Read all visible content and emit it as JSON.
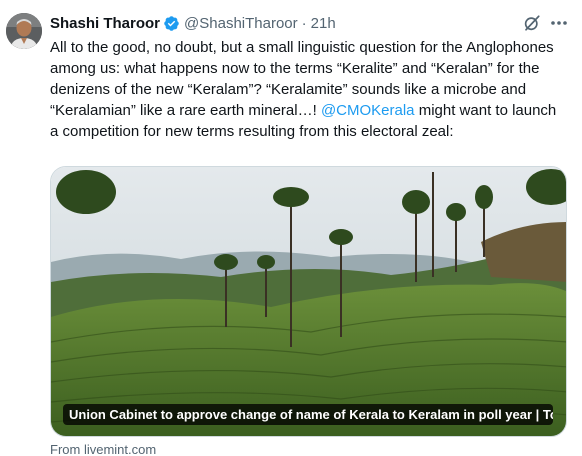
{
  "author": {
    "name": "Shashi Tharoor",
    "handle": "@ShashiTharoor",
    "separator": "·",
    "time": "21h"
  },
  "tweet": {
    "text_before": "All to the good, no doubt, but a small linguistic question for the Anglophones among us: what happens now to the terms “Keralite” and “Keralan” for the denizens of the new “Keralam”? “Keralamite” sounds like a microbe and “Keralamian” like a rare earth mineral…! ",
    "mention": "@CMOKerala",
    "text_after": " might want to launch a competition for new terms resulting from this electoral zeal:"
  },
  "card": {
    "caption": "Union Cabinet to approve change of name of Kerala to Keralam in poll year | To...",
    "source": "From livemint.com"
  },
  "icons": {
    "verified": "verified-badge-icon",
    "grok": "grok-icon",
    "more": "more-options-icon"
  },
  "colors": {
    "accent": "#1d9bf0",
    "text": "#0f1419",
    "secondary": "#536471"
  }
}
